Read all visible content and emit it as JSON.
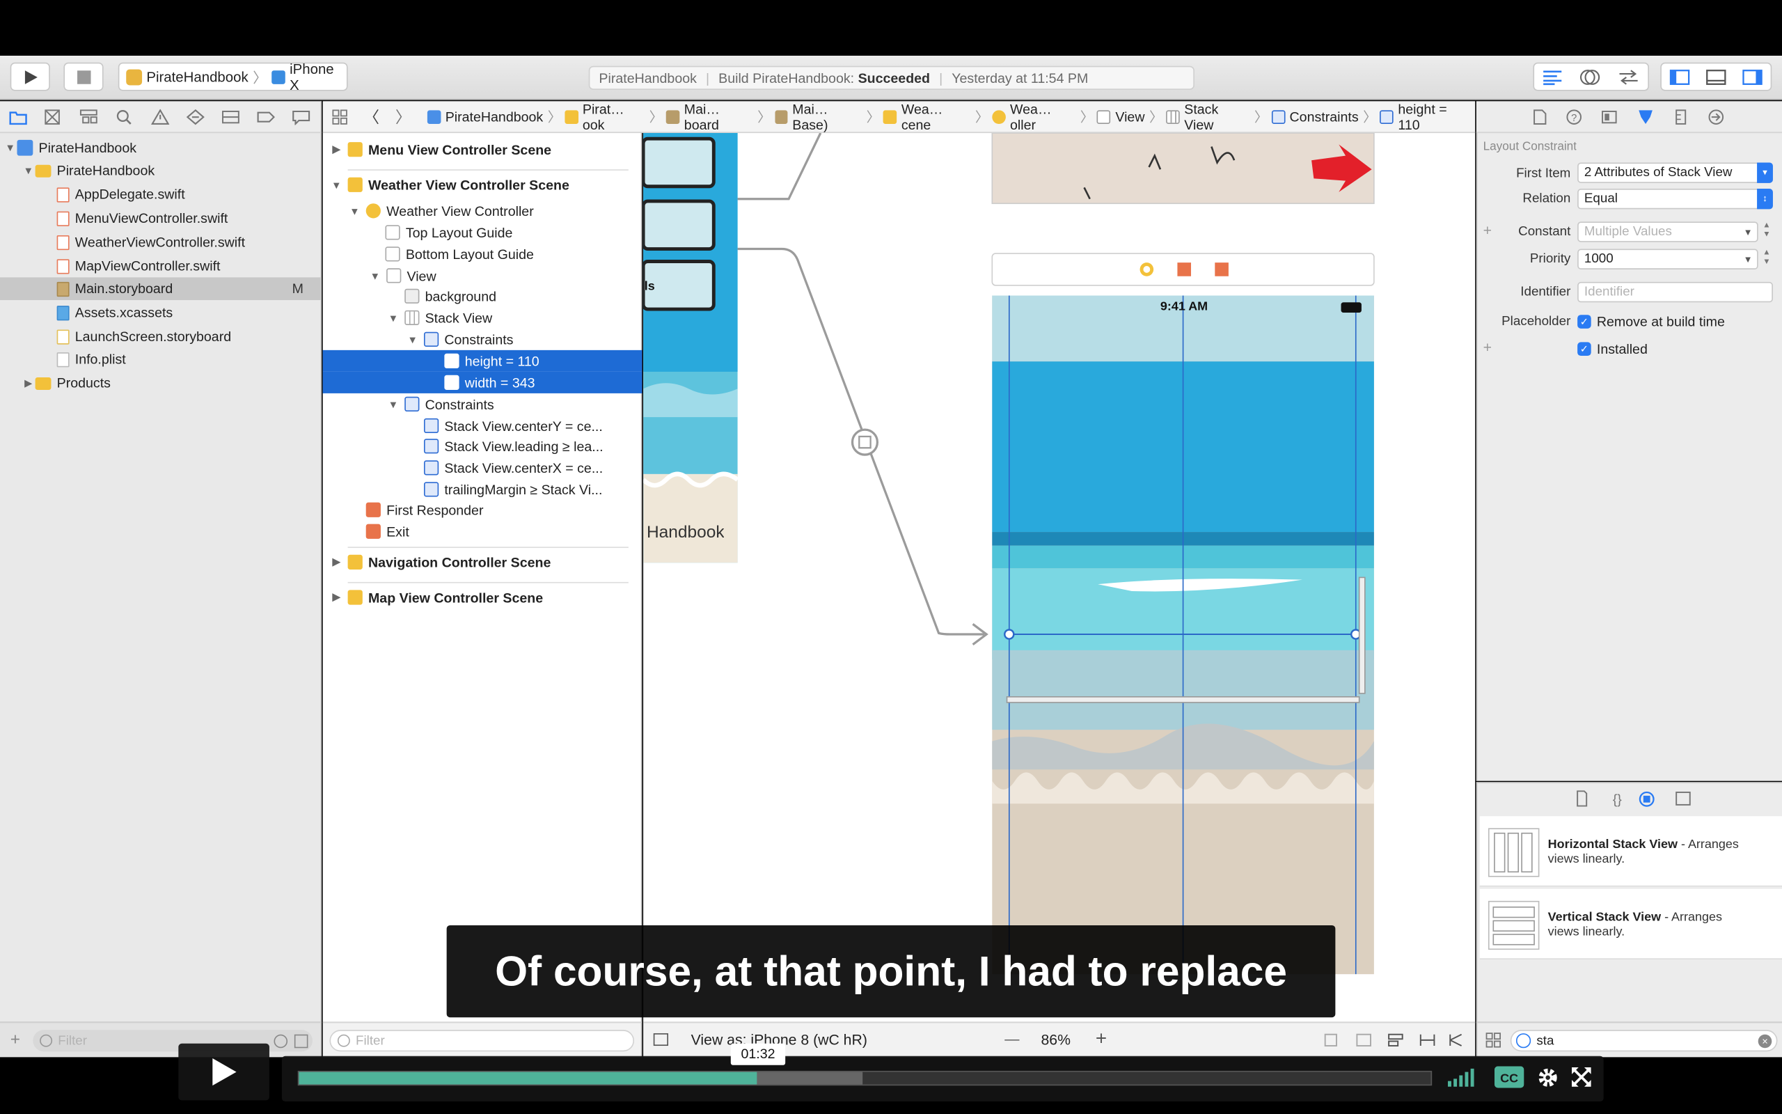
{
  "toolbar": {
    "scheme_app": "PirateHandbook",
    "scheme_device": "iPhone X",
    "status_project": "PirateHandbook",
    "status_build": "Build PirateHandbook:",
    "status_result": "Succeeded",
    "status_time": "Yesterday at 11:54 PM"
  },
  "jump_bar": [
    "PirateHandbook",
    "Pirat…ook",
    "Mai…board",
    "Mai…Base)",
    "Wea…cene",
    "Wea…oller",
    "View",
    "Stack View",
    "Constraints",
    "height = 110"
  ],
  "navigator": {
    "project": "PirateHandbook",
    "group": "PirateHandbook",
    "files": [
      "AppDelegate.swift",
      "MenuViewController.swift",
      "WeatherViewController.swift",
      "MapViewController.swift",
      "Main.storyboard",
      "Assets.xcassets",
      "LaunchScreen.storyboard",
      "Info.plist"
    ],
    "selected_badge": "M",
    "products": "Products",
    "filter_placeholder": "Filter"
  },
  "outline": {
    "scenes": [
      "Menu View Controller Scene",
      "Weather View Controller Scene",
      "Navigation Controller Scene",
      "Map View Controller Scene"
    ],
    "items": [
      "Weather View Controller",
      "Top Layout Guide",
      "Bottom Layout Guide",
      "View",
      "background",
      "Stack View",
      "Constraints",
      "height = 110",
      "width = 343",
      "Constraints",
      "Stack View.centerY = ce...",
      "Stack View.leading ≥ lea...",
      "Stack View.centerX = ce...",
      "trailingMargin ≥ Stack Vi...",
      "First Responder",
      "Exit"
    ],
    "filter_placeholder": "Filter"
  },
  "canvas": {
    "menu_partial_text": "Handbook",
    "button_partial_text": "ls",
    "device_time": "9:41 AM",
    "view_as": "View as: iPhone 8 (wC hR)",
    "zoom_minus": "—",
    "zoom": "86%",
    "zoom_plus": "+"
  },
  "inspector": {
    "section": "Layout Constraint",
    "first_item_label": "First Item",
    "first_item_value": "2 Attributes of Stack View",
    "relation_label": "Relation",
    "relation_value": "Equal",
    "constant_label": "Constant",
    "constant_placeholder": "Multiple Values",
    "priority_label": "Priority",
    "priority_value": "1000",
    "identifier_label": "Identifier",
    "identifier_placeholder": "Identifier",
    "placeholder_label": "Placeholder",
    "placeholder_option": "Remove at build time",
    "installed_label": "Installed",
    "plus": "+"
  },
  "library": {
    "items": [
      {
        "title": "Horizontal Stack View",
        "desc_1": " - Arranges",
        "desc_2": "views linearly."
      },
      {
        "title": "Vertical Stack View",
        "desc_1": " - Arranges",
        "desc_2": "views linearly."
      }
    ],
    "search_value": "sta"
  },
  "player": {
    "caption": "Of course, at that point, I had to replace",
    "time": "01:32",
    "progress_played": 0.405,
    "progress_loaded": 0.498
  },
  "colors": {
    "accent": "#1e6bd5",
    "player_progress": "#4fb39a",
    "sea": "#29a9dc",
    "sand": "#dcd0c0"
  }
}
